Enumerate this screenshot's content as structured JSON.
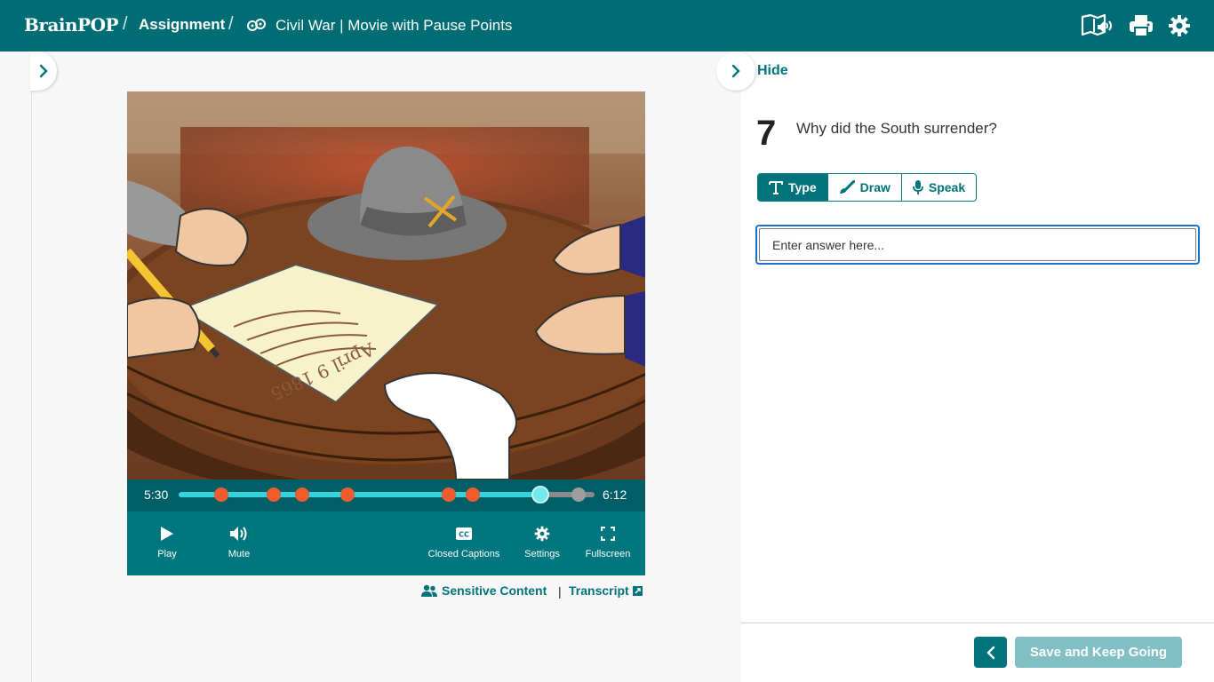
{
  "header": {
    "logo": "BrainPOP",
    "separator": "/",
    "breadcrumb_assignment": "Assignment",
    "movie_title": "Civil War | Movie with Pause Points",
    "icons": [
      "read-aloud-icon",
      "print-icon",
      "gear-icon"
    ]
  },
  "player": {
    "current_time": "5:30",
    "total_time": "6:12",
    "progress_fraction": 0.87,
    "pause_points_fraction": [
      0.102,
      0.228,
      0.297,
      0.406,
      0.65,
      0.707
    ],
    "controls": {
      "play": "Play",
      "mute": "Mute",
      "captions": "Closed Captions",
      "settings": "Settings",
      "fullscreen": "Fullscreen"
    },
    "icon_captions": "CC",
    "document_date": "April 9 1865"
  },
  "links": {
    "sensitive": "Sensitive Content",
    "separator": "|",
    "transcript": "Transcript"
  },
  "question": {
    "hide_label": "Hide",
    "number": "7",
    "text": "Why did the South surrender?",
    "modes": [
      "Type",
      "Draw",
      "Speak"
    ],
    "active_mode": "Type",
    "answer_placeholder": "Enter answer here..."
  },
  "footer": {
    "save_label": "Save and Keep Going"
  },
  "colors": {
    "brand_teal": "#006d75",
    "accent_teal": "#00737b",
    "pause_point": "#ef5d2f",
    "progress": "#37d2dc"
  }
}
